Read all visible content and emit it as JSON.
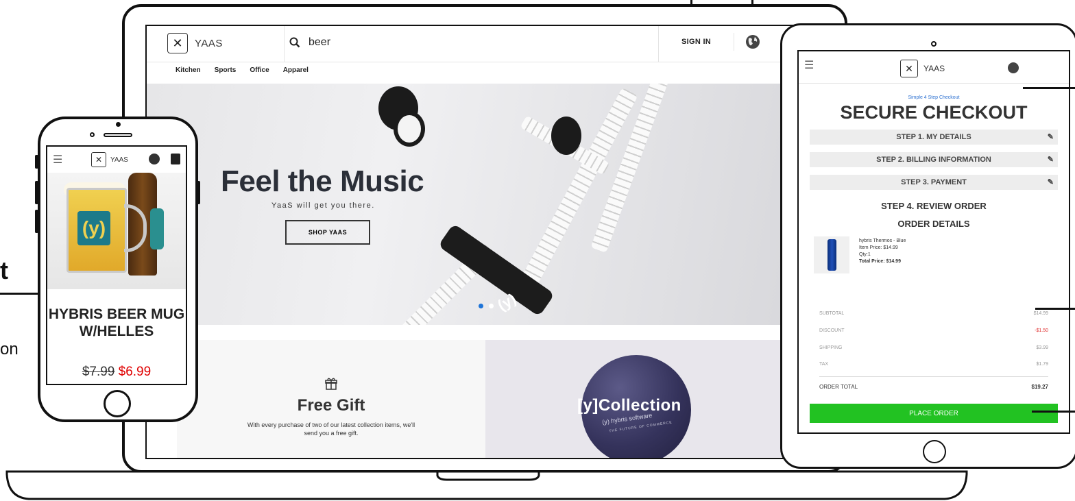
{
  "desktop": {
    "logo_text": "YAAS",
    "search_value": "beer",
    "sign_in": "SIGN IN",
    "nav": [
      "Kitchen",
      "Sports",
      "Office",
      "Apparel"
    ],
    "hero": {
      "title": "Feel the Music",
      "subtitle": "YaaS will get you there.",
      "button": "SHOP YAAS"
    },
    "gift": {
      "title": "Free Gift",
      "text": "With every purchase of two of our latest collection items,  we'll send you a free gift."
    },
    "collection": {
      "title": "[y]Collection",
      "ball_brand": "(y) hybris software",
      "ball_sub": "THE FUTURE OF COMMERCE"
    }
  },
  "left_labels": {
    "big": "t",
    "small": "on"
  },
  "phone": {
    "logo_text": "YAAS",
    "product_title": "HYBRIS BEER MUG W/HELLES",
    "old_price": "$7.99",
    "new_price": "$6.99"
  },
  "tablet": {
    "logo_text": "YAAS",
    "kicker": "Simple 4 Step Checkout",
    "title": "SECURE CHECKOUT",
    "steps": [
      "STEP 1. MY DETAILS",
      "STEP 2. BILLING INFORMATION",
      "STEP 3. PAYMENT"
    ],
    "step4": "STEP 4. REVIEW ORDER",
    "order_details": "ORDER DETAILS",
    "product": {
      "name": "hybris Thermos - Blue",
      "item_price": "Item Price: $14.99",
      "qty": "Qty:1",
      "total_price": "Total Price: $14.99"
    },
    "summary": [
      {
        "label": "SUBTOTAL",
        "value": "$14.99"
      },
      {
        "label": "DISCOUNT",
        "value": "-$1.50"
      },
      {
        "label": "SHIPPING",
        "value": "$3.99"
      },
      {
        "label": "TAX",
        "value": "$1.79"
      }
    ],
    "order_total_label": "ORDER TOTAL",
    "order_total_value": "$19.27",
    "place_order": "PLACE ORDER"
  },
  "colors": {
    "price_red": "#e00000",
    "place_order_green": "#22c222",
    "kicker_blue": "#2a6fd0",
    "discount_red": "#e03030"
  }
}
